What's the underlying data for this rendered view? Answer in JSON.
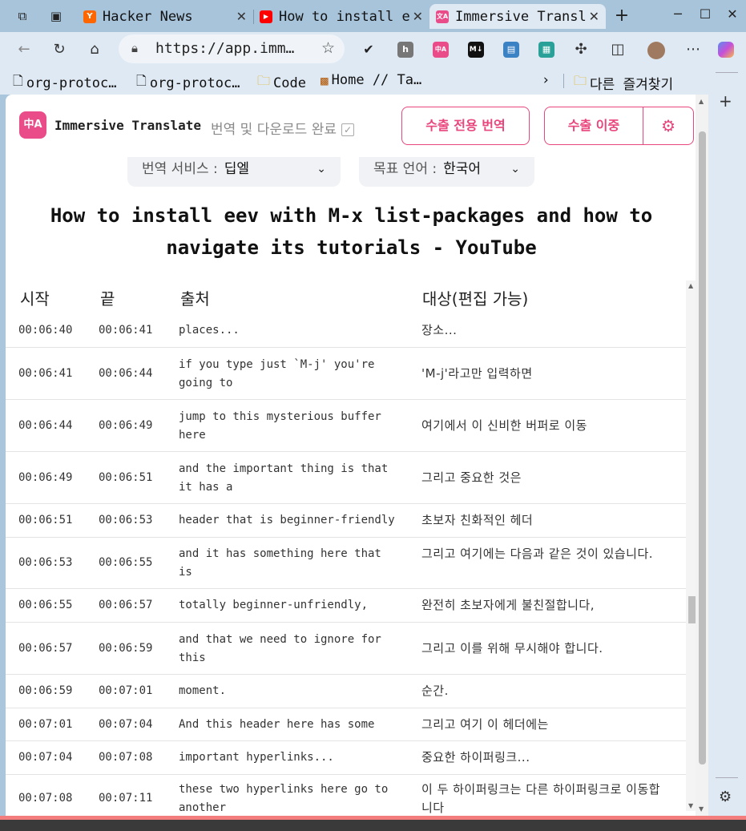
{
  "browser": {
    "tabs": [
      {
        "title": "Hacker News",
        "favicon": "Y",
        "color": "#ff6600"
      },
      {
        "title": "How to install e",
        "favicon": "▶",
        "color": "#ff0000"
      },
      {
        "title": "Immersive Transl",
        "favicon": "文A",
        "color": "#ea4c89"
      }
    ],
    "new_tab": "+",
    "url": "https://app.imm…",
    "bookmarks": [
      {
        "label": "org-protoc…"
      },
      {
        "label": "org-protoc…"
      },
      {
        "label": "Code"
      },
      {
        "label": "Home // Ta…"
      }
    ],
    "other_bookmarks": "다른 즐겨찾기"
  },
  "app": {
    "logo_text": "中A",
    "name": "Immersive Translate",
    "status": "번역 및 다운로드 완료",
    "export_translation_label": "수출 전용 번역",
    "export_bilingual_label": "수출 이중",
    "service_label": "번역 서비스 :",
    "service_value": "딥엘",
    "target_label": "목표 언어 :",
    "target_value": "한국어",
    "accent": "#ea4c89"
  },
  "document": {
    "title": "How to install eev with M-x list-packages and how to navigate its tutorials - YouTube"
  },
  "table": {
    "headers": {
      "start": "시작",
      "end": "끝",
      "source": "출처",
      "target": "대상(편집 가능)"
    },
    "rows": [
      {
        "start": "00:06:40",
        "end": "00:06:41",
        "source": "places...",
        "target": "장소..."
      },
      {
        "start": "00:06:41",
        "end": "00:06:44",
        "source": "if you type just `M-j' you're going to",
        "target": "'M-j'라고만 입력하면"
      },
      {
        "start": "00:06:44",
        "end": "00:06:49",
        "source": "jump to this mysterious buffer here",
        "target": "여기에서 이 신비한 버퍼로 이동"
      },
      {
        "start": "00:06:49",
        "end": "00:06:51",
        "source": "and the important thing is that it has a",
        "target": "그리고 중요한 것은"
      },
      {
        "start": "00:06:51",
        "end": "00:06:53",
        "source": "header that is beginner-friendly",
        "target": "초보자 친화적인 헤더"
      },
      {
        "start": "00:06:53",
        "end": "00:06:55",
        "source": "and it has something here that is",
        "target": "그리고 여기에는 다음과 같은 것이 있습니다."
      },
      {
        "start": "00:06:55",
        "end": "00:06:57",
        "source": "totally beginner-unfriendly,",
        "target": "완전히 초보자에게 불친절합니다,"
      },
      {
        "start": "00:06:57",
        "end": "00:06:59",
        "source": "and that we need to ignore for this",
        "target": "그리고 이를 위해 무시해야 합니다."
      },
      {
        "start": "00:06:59",
        "end": "00:07:01",
        "source": "moment.",
        "target": "순간."
      },
      {
        "start": "00:07:01",
        "end": "00:07:04",
        "source": "And this header here has some",
        "target": "그리고 여기 이 헤더에는"
      },
      {
        "start": "00:07:04",
        "end": "00:07:08",
        "source": "important hyperlinks...",
        "target": "중요한 하이퍼링크..."
      },
      {
        "start": "00:07:08",
        "end": "00:07:11",
        "source": "these two hyperlinks here go to another",
        "target": "이 두 하이퍼링크는 다른 하이퍼링크로 이동합니다"
      }
    ]
  }
}
